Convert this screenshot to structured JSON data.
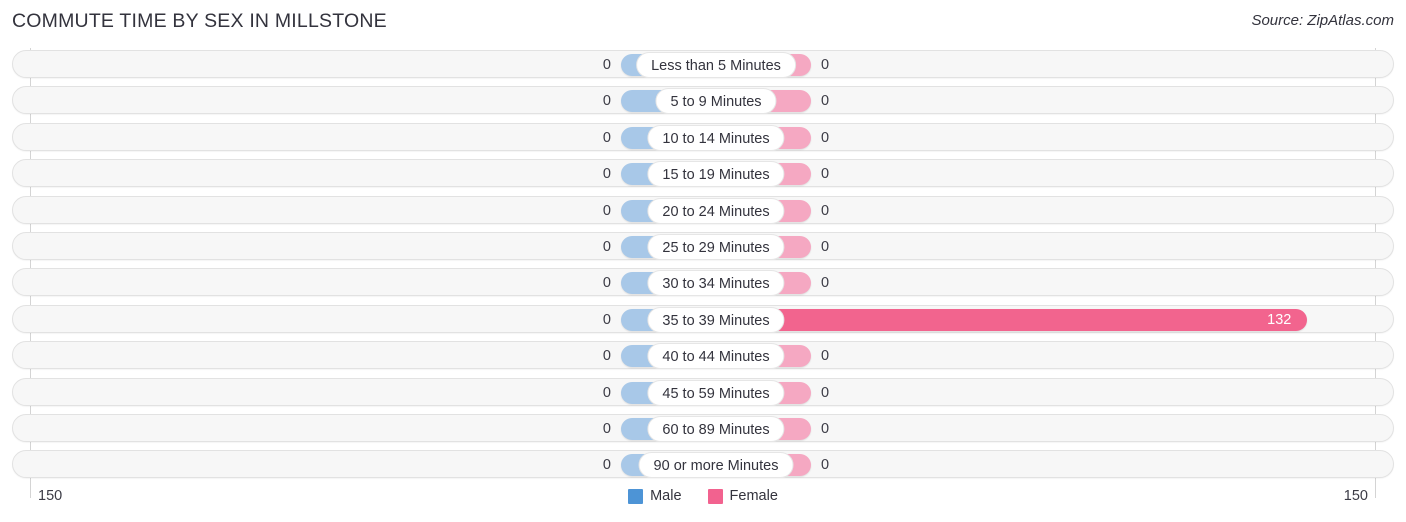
{
  "header": {
    "title": "COMMUTE TIME BY SEX IN MILLSTONE",
    "source": "Source: ZipAtlas.com"
  },
  "axis": {
    "left_tick": "150",
    "right_tick": "150"
  },
  "legend": {
    "items": [
      {
        "label": "Male",
        "color": "#4d94d6",
        "name": "legend-swatch-male"
      },
      {
        "label": "Female",
        "color": "#f2628f",
        "name": "legend-swatch-female"
      }
    ]
  },
  "colors": {
    "male_bar": "#a8c8e8",
    "female_bar": "#f5a8c2",
    "female_bar_highlight": "#f2648e",
    "track_fill": "#f7f7f7",
    "track_border": "#e2e2e2",
    "title_text": "#33333d"
  },
  "chart_data": {
    "type": "bar",
    "subtype": "diverging-bar",
    "title": "COMMUTE TIME BY SEX IN MILLSTONE",
    "xlabel": "",
    "ylabel": "",
    "xlim": [
      150,
      150
    ],
    "axis_max": 150,
    "grid": false,
    "legend_position": "bottom-center",
    "categories": [
      "Less than 5 Minutes",
      "5 to 9 Minutes",
      "10 to 14 Minutes",
      "15 to 19 Minutes",
      "20 to 24 Minutes",
      "25 to 29 Minutes",
      "30 to 34 Minutes",
      "35 to 39 Minutes",
      "40 to 44 Minutes",
      "45 to 59 Minutes",
      "60 to 89 Minutes",
      "90 or more Minutes"
    ],
    "series": [
      {
        "name": "Male",
        "direction": "left",
        "values": [
          0,
          0,
          0,
          0,
          0,
          0,
          0,
          0,
          0,
          0,
          0,
          0
        ],
        "labels": [
          "0",
          "0",
          "0",
          "0",
          "0",
          "0",
          "0",
          "0",
          "0",
          "0",
          "0",
          "0"
        ]
      },
      {
        "name": "Female",
        "direction": "right",
        "values": [
          0,
          0,
          0,
          0,
          0,
          0,
          0,
          132,
          0,
          0,
          0,
          0
        ],
        "labels": [
          "0",
          "0",
          "0",
          "0",
          "0",
          "0",
          "0",
          "132",
          "0",
          "0",
          "0",
          "0"
        ]
      }
    ]
  }
}
